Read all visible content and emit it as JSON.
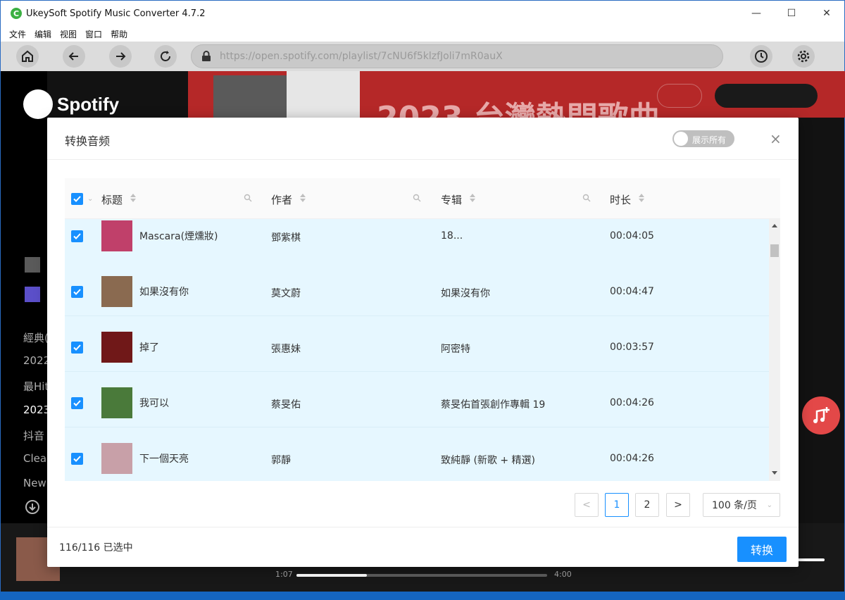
{
  "app": {
    "title": "UkeySoft Spotify Music Converter 4.7.2",
    "logo": "C"
  },
  "window_controls": {
    "minimize": "—",
    "maximize": "☐",
    "close": "✕"
  },
  "menu": [
    "文件",
    "编辑",
    "视图",
    "窗口",
    "帮助"
  ],
  "toolbar": {
    "url": "https://open.spotify.com/playlist/7cNU6f5klzfJoli7mR0auX"
  },
  "spotify": {
    "brand": "Spotify",
    "banner": "2023 台灣熱門歌曲",
    "sidebar_items": [
      "經典(",
      "2022",
      "最Hit",
      "2023",
      "抖音",
      "Clear",
      "New"
    ],
    "player": {
      "elapsed": "1:07",
      "total": "4:00",
      "progress": 0.28
    }
  },
  "dialog": {
    "title": "转换音频",
    "toggle_label": "展示所有",
    "close": "×",
    "columns": {
      "title": "标题",
      "artist": "作者",
      "album": "专辑",
      "duration": "时长"
    },
    "rows": [
      {
        "title": "Mascara(煙燻妝)",
        "artist": "鄧紫棋",
        "album": "18...",
        "duration": "00:04:05",
        "color": "#c0406a"
      },
      {
        "title": "如果沒有你",
        "artist": "莫文蔚",
        "album": "如果沒有你",
        "duration": "00:04:47",
        "color": "#8a6a50"
      },
      {
        "title": "掉了",
        "artist": "張惠妹",
        "album": "阿密特",
        "duration": "00:03:57",
        "color": "#701818"
      },
      {
        "title": "我可以",
        "artist": "蔡旻佑",
        "album": "蔡旻佑首張創作專輯 19",
        "duration": "00:04:26",
        "color": "#4a7a3a"
      },
      {
        "title": "下一個天亮",
        "artist": "郭靜",
        "album": "致純靜 (新歌 + 精選)",
        "duration": "00:04:26",
        "color": "#c8a0a8"
      }
    ],
    "pagination": {
      "prev": "<",
      "pages": [
        "1",
        "2"
      ],
      "next": ">",
      "page_size": "100 条/页"
    },
    "footer": {
      "selected": "116/116 已选中",
      "convert": "转换"
    }
  },
  "colors": {
    "accent": "#1890ff",
    "row_selected": "#e6f7ff",
    "spotify_banner": "#b52828"
  }
}
